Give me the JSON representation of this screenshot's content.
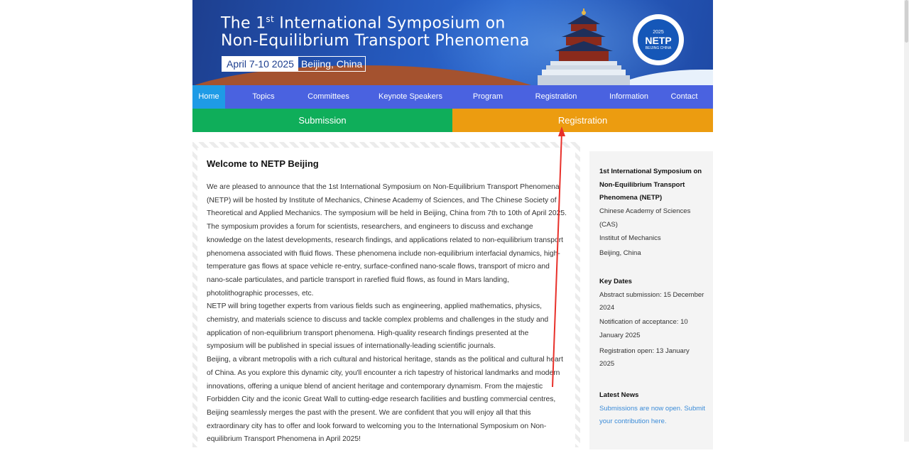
{
  "banner": {
    "title_line1_pre": "The 1",
    "title_line1_sup": "st",
    "title_line1_post": " International Symposium on",
    "title_line2": "Non-Equilibrium Transport Phenomena",
    "dates": "April 7-10 2025",
    "location": "Beijing, China",
    "logo_year": "2025",
    "logo_name": "NETP",
    "logo_city": "BEIJING CHINA"
  },
  "nav": {
    "items": [
      "Home",
      "Topics",
      "Committees",
      "Keynote Speakers",
      "Program",
      "Registration",
      "Information",
      "Contact"
    ],
    "active": "Home"
  },
  "actions": {
    "submission": "Submission",
    "registration": "Registration"
  },
  "main": {
    "heading": "Welcome to NETP Beijing",
    "paragraphs": [
      "We are pleased to announce that the 1st International Symposium on Non-Equilibrium Transport Phenomena (NETP) will be hosted by Institute of Mechanics, Chinese Academy of Sciences, and The Chinese Society of Theoretical and Applied Mechanics. The symposium will be held in Beijing, China from 7th to 10th of April 2025. The symposium provides a forum for scientists, researchers, and engineers to discuss and exchange knowledge on the latest developments, research findings, and applications related to non-equilibrium transport phenomena associated with fluid flows. These phenomena include non-equilibrium interfacial dynamics, high-temperature gas flows at space vehicle re-entry, surface-confined nano-scale flows, transport of micro and nano-scale particulates, and particle transport in rarefied fluid flows, as found in Mars landing, photolithographic processes, etc.",
      "NETP will bring together experts from various fields such as engineering, applied mathematics, physics, chemistry, and materials science to discuss and tackle complex problems and challenges in the study and application of non-equilibrium transport phenomena. High-quality research findings presented at the symposium will be published in special issues of internationally-leading scientific journals.",
      "Beijing, a vibrant metropolis with a rich cultural and historical heritage, stands as the political and cultural heart of China. As you explore this dynamic city, you'll encounter a rich tapestry of historical landmarks and modern innovations, offering a unique blend of ancient heritage and contemporary dynamism. From the majestic Forbidden City and the iconic Great Wall to cutting-edge research facilities and bustling commercial centres, Beijing seamlessly merges the past with the present. We are confident that you will enjoy all that this extraordinary city has to offer and look forward to welcoming you to the International Symposium on Non-equilibrium Transport Phenomena in April 2025!"
    ]
  },
  "sidebar": {
    "org_title": "1st International Symposium on Non-Equilibrium Transport Phenomena (NETP)",
    "org_line1": "Chinese Academy of Sciences (CAS)",
    "org_line2": "Institut of Mechanics",
    "org_line3": "Beijing, China",
    "dates_title": "Key Dates",
    "date1": "Abstract submission: 15 December 2024",
    "date2": "Notification of acceptance: 10 January 2025",
    "date3": "Registration open: 13 January 2025",
    "news_title": "Latest News",
    "news_link": "Submissions are now open. Submit your contribution here."
  },
  "colors": {
    "nav": "#4a62e0",
    "nav_active": "#1e9be6",
    "submission": "#0fae5a",
    "registration": "#ec9c10",
    "link": "#3a8bd8",
    "arrow": "#e8302a"
  }
}
